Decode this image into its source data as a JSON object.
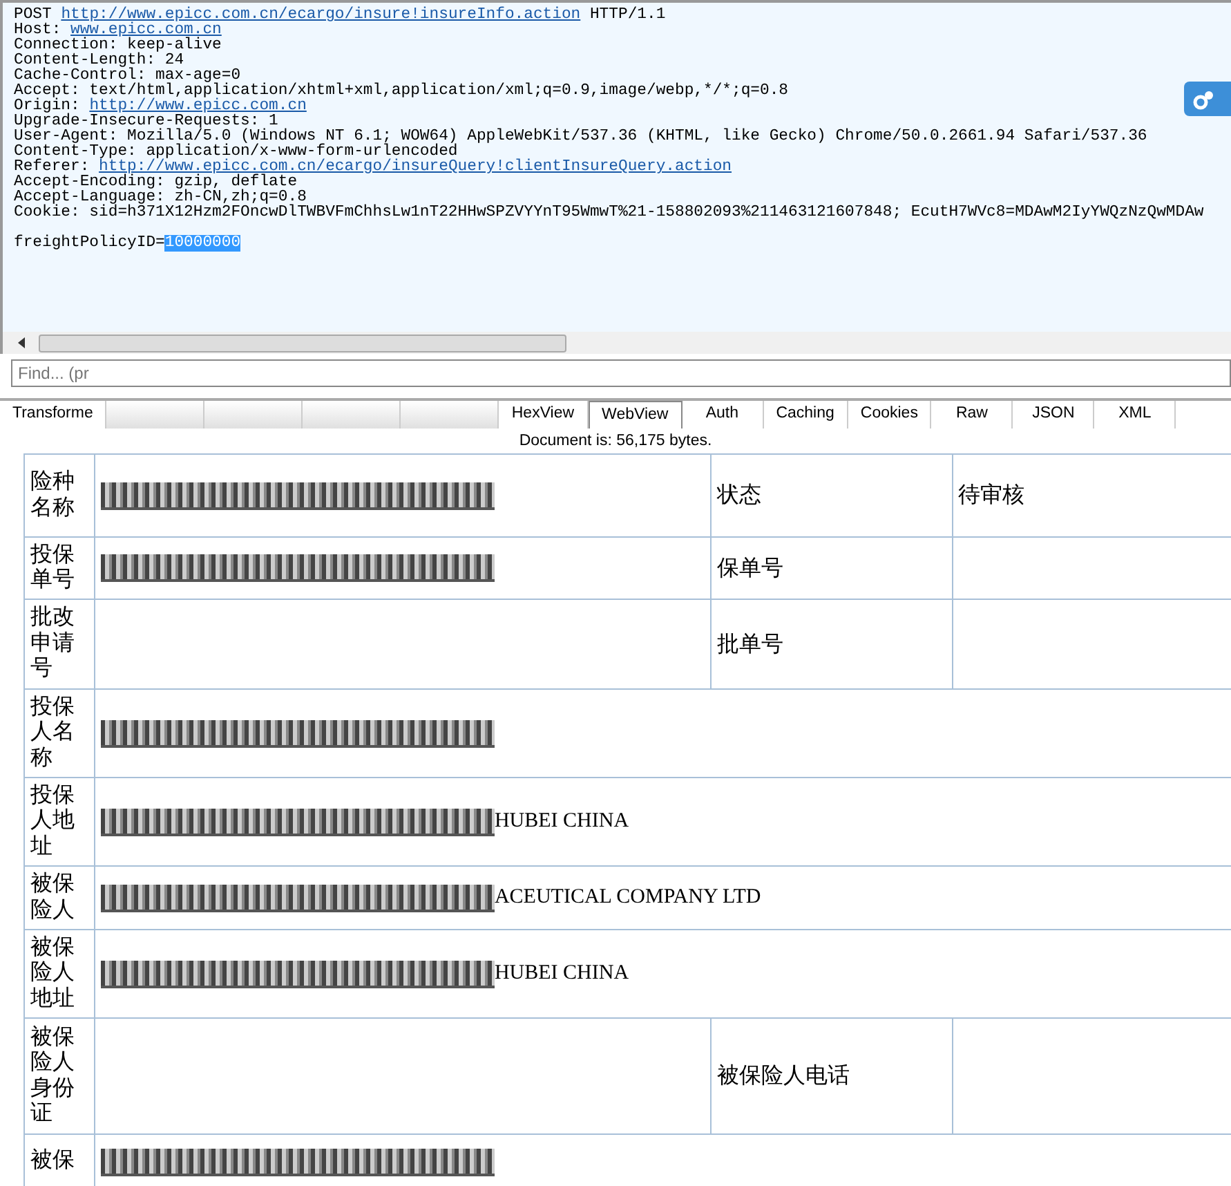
{
  "request": {
    "lines": [
      {
        "prefix": "POST ",
        "link": "http://www.epicc.com.cn/ecargo/insure!insureInfo.action",
        "suffix": " HTTP/1.1"
      },
      {
        "prefix": "Host: ",
        "link": "www.epicc.com.cn"
      },
      {
        "prefix": "Connection: keep-alive"
      },
      {
        "prefix": "Content-Length: 24"
      },
      {
        "prefix": "Cache-Control: max-age=0"
      },
      {
        "prefix": "Accept: text/html,application/xhtml+xml,application/xml;q=0.9,image/webp,*/*;q=0.8"
      },
      {
        "prefix": "Origin: ",
        "link": "http://www.epicc.com.cn"
      },
      {
        "prefix": "Upgrade-Insecure-Requests: 1"
      },
      {
        "prefix": "User-Agent: Mozilla/5.0 (Windows NT 6.1; WOW64) AppleWebKit/537.36 (KHTML, like Gecko) Chrome/50.0.2661.94 Safari/537.36"
      },
      {
        "prefix": "Content-Type: application/x-www-form-urlencoded"
      },
      {
        "prefix": "Referer: ",
        "link": "http://www.epicc.com.cn/ecargo/insureQuery!clientInsureQuery.action"
      },
      {
        "prefix": "Accept-Encoding: gzip, deflate"
      },
      {
        "prefix": "Accept-Language: zh-CN,zh;q=0.8"
      },
      {
        "prefix": "Cookie: sid=h371X12Hzm2FOncwDlTWBVFmChhsLw1nT22HHwSPZVYYnT95WmwT%21-158802093%211463121607848; EcutH7WVc8=MDAwM2IyYWQzNzQwMDAw"
      },
      {
        "prefix": "freightPolicyID=",
        "selected": "10000000",
        "kind": "body"
      }
    ]
  },
  "find": {
    "placeholder": "Find... (pr"
  },
  "tabs": [
    {
      "label": "Transforme",
      "selected": false,
      "redacted": false
    },
    {
      "selected": false,
      "redacted": true
    },
    {
      "selected": false,
      "redacted": true
    },
    {
      "selected": false,
      "redacted": true
    },
    {
      "selected": false,
      "redacted": true
    },
    {
      "label": "HexView",
      "selected": false,
      "redacted": false
    },
    {
      "label": "WebView",
      "selected": true,
      "redacted": false
    },
    {
      "label": "Auth",
      "selected": false,
      "redacted": false
    },
    {
      "label": "Caching",
      "selected": false,
      "redacted": false
    },
    {
      "label": "Cookies",
      "selected": false,
      "redacted": false
    },
    {
      "label": "Raw",
      "selected": false,
      "redacted": false
    },
    {
      "label": "JSON",
      "selected": false,
      "redacted": false
    },
    {
      "label": "XML",
      "selected": false,
      "redacted": false
    }
  ],
  "document_size": "Document is: 56,175 bytes.",
  "table": {
    "rows": [
      {
        "label": "险种名称",
        "redacted": true,
        "label2": "状态",
        "value2": "待审核"
      },
      {
        "label": "投保单号",
        "redacted": true,
        "label2": "保单号"
      },
      {
        "label": "批改申请号",
        "redacted": false,
        "label2": "批单号"
      },
      {
        "label": "投保人名称",
        "redacted": true
      },
      {
        "label": "投保人地址",
        "redacted": true,
        "value": "HUBEI CHINA"
      },
      {
        "label": "被保险人",
        "redacted": true,
        "value": "ACEUTICAL COMPANY LTD"
      },
      {
        "label": "被保险人地址",
        "redacted": true,
        "value": "HUBEI CHINA"
      },
      {
        "label": "被保险人身份证",
        "redacted": false,
        "label2": "被保险人电话"
      },
      {
        "label": "被保",
        "redacted": true
      }
    ]
  }
}
